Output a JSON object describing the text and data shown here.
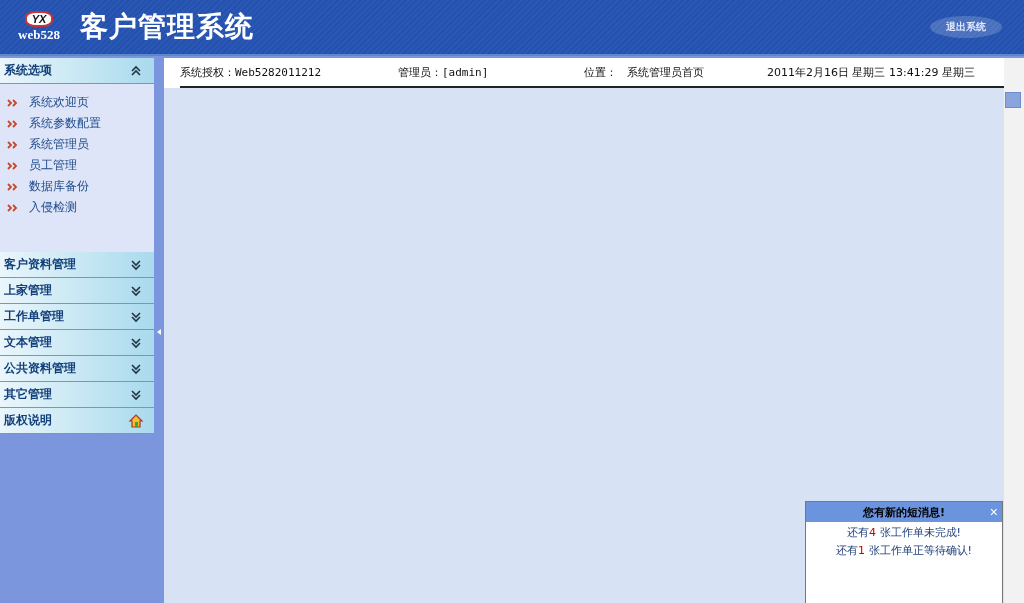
{
  "header": {
    "logo_mark": "YX",
    "logo_text": "web528",
    "title": "客户管理系统",
    "logout": "退出系统"
  },
  "sidebar": {
    "sections": [
      {
        "title": "系统选项",
        "kind": "toggle",
        "expanded": true,
        "items": [
          "系统欢迎页",
          "系统参数配置",
          "系统管理员",
          "员工管理",
          "数据库备份",
          "入侵检测"
        ]
      },
      {
        "title": "客户资料管理",
        "kind": "toggle",
        "expanded": false
      },
      {
        "title": "上家管理",
        "kind": "toggle",
        "expanded": false
      },
      {
        "title": "工作单管理",
        "kind": "toggle",
        "expanded": false
      },
      {
        "title": "文本管理",
        "kind": "toggle",
        "expanded": false
      },
      {
        "title": "公共资料管理",
        "kind": "toggle",
        "expanded": false
      },
      {
        "title": "其它管理",
        "kind": "toggle",
        "expanded": false
      },
      {
        "title": "版权说明",
        "kind": "home"
      }
    ]
  },
  "info_bar": {
    "license": "系统授权：Web5282011212",
    "admin": "管理员：[admin]",
    "location_label": "位置：",
    "location": "系统管理员首页",
    "datetime": "2011年2月16日 星期三 13:41:29 星期三"
  },
  "popup": {
    "title": "您有新的短消息!",
    "close": "×",
    "messages": [
      "还有**4** 张工作单未完成!",
      "还有**1** 张工作单正等待确认!"
    ]
  }
}
